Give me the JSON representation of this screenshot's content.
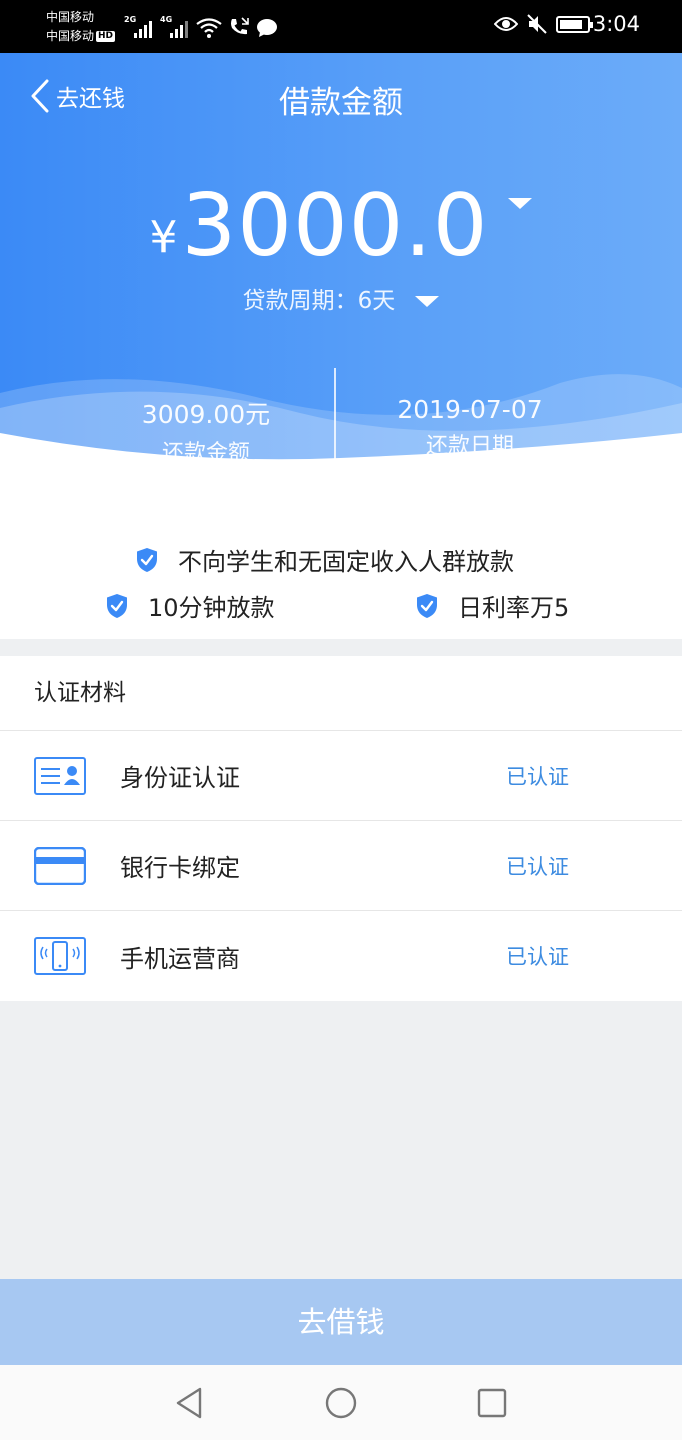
{
  "status_bar": {
    "carrier_1": "中国移动",
    "carrier_2": "中国移动",
    "hd_badge": "HD",
    "net_1": "2G",
    "net_2": "4G",
    "time": "3:04",
    "battery_level": 0.85
  },
  "header": {
    "back_label": "去还钱",
    "title": "借款金额"
  },
  "loan": {
    "currency": "¥",
    "amount": "3000.0",
    "period": "贷款周期：6天"
  },
  "summary": {
    "repay_amount_value": "3009.00元",
    "repay_amount_label": "还款金额",
    "repay_date_value": "2019-07-07",
    "repay_date_label": "还款日期"
  },
  "features": [
    {
      "text": "不向学生和无固定收入人群放款",
      "icon": "shield-check-icon"
    },
    {
      "text": "10分钟放款",
      "icon": "shield-check-icon"
    },
    {
      "text": "日利率万5",
      "icon": "shield-check-icon"
    }
  ],
  "certification": {
    "title": "认证材料",
    "items": [
      {
        "label": "身份证认证",
        "status": "已认证",
        "icon": "id-card-icon"
      },
      {
        "label": "银行卡绑定",
        "status": "已认证",
        "icon": "bank-card-icon"
      },
      {
        "label": "手机运营商",
        "status": "已认证",
        "icon": "phone-carrier-icon"
      }
    ]
  },
  "borrow_button": "去借钱",
  "colors": {
    "brand_blue": "#3b8af6",
    "status_blue": "#3d8be0",
    "button_disabled": "#a7c8f2"
  }
}
